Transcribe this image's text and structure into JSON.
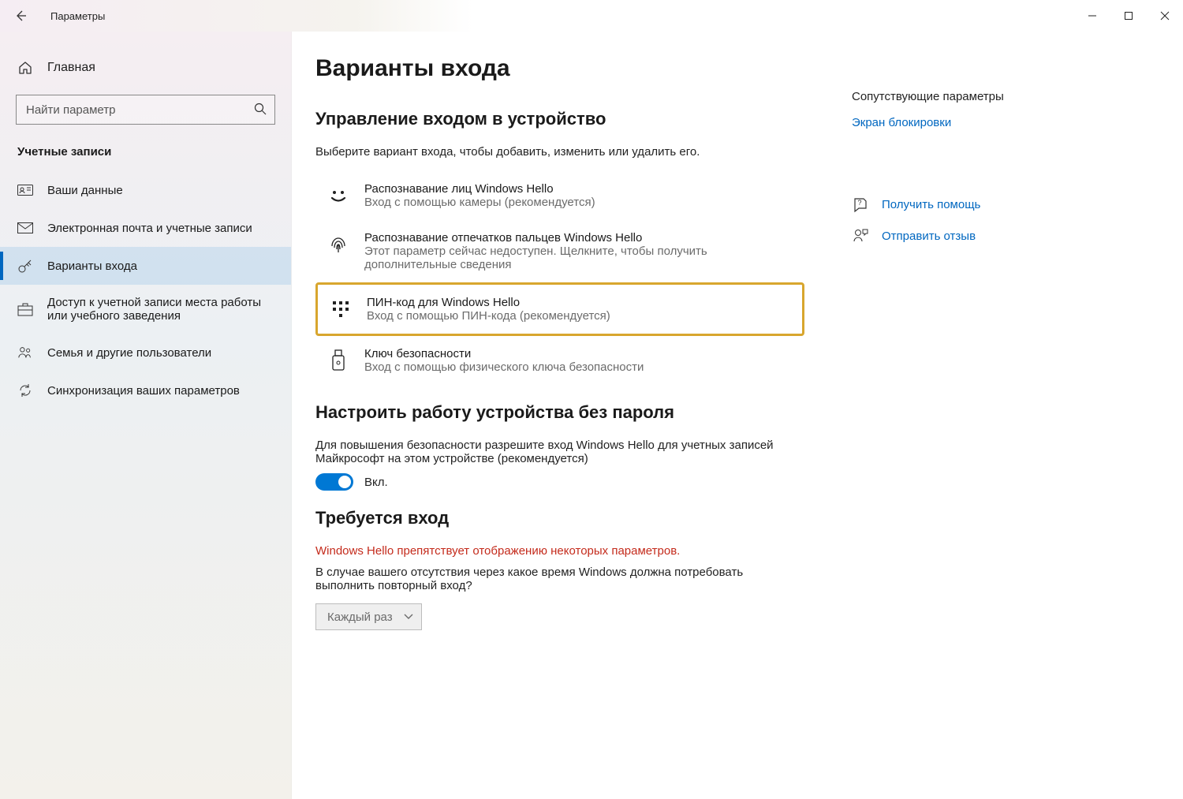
{
  "window": {
    "title": "Параметры"
  },
  "sidebar": {
    "home": "Главная",
    "search_placeholder": "Найти параметр",
    "category": "Учетные записи",
    "items": [
      {
        "label": "Ваши данные"
      },
      {
        "label": "Электронная почта и учетные записи"
      },
      {
        "label": "Варианты входа"
      },
      {
        "label": "Доступ к учетной записи места работы или учебного заведения"
      },
      {
        "label": "Семья и другие пользователи"
      },
      {
        "label": "Синхронизация ваших параметров"
      }
    ]
  },
  "main": {
    "title": "Варианты входа",
    "manage_heading": "Управление входом в устройство",
    "manage_lead": "Выберите вариант входа, чтобы добавить, изменить или удалить его.",
    "options": [
      {
        "title": "Распознавание лиц Windows Hello",
        "desc": "Вход с помощью камеры (рекомендуется)"
      },
      {
        "title": "Распознавание отпечатков пальцев Windows Hello",
        "desc": "Этот параметр сейчас недоступен. Щелкните, чтобы получить дополнительные сведения"
      },
      {
        "title": "ПИН-код для Windows Hello",
        "desc": "Вход с помощью ПИН-кода (рекомендуется)"
      },
      {
        "title": "Ключ безопасности",
        "desc": "Вход с помощью физического ключа безопасности"
      }
    ],
    "passwordless_heading": "Настроить работу устройства без пароля",
    "passwordless_lead": "Для повышения безопасности разрешите вход Windows Hello для учетных записей Майкрософт на этом устройстве (рекомендуется)",
    "toggle_label": "Вкл.",
    "require_heading": "Требуется вход",
    "require_warning": "Windows Hello препятствует отображению некоторых параметров.",
    "require_text": "В случае вашего отсутствия через какое время Windows должна потребовать выполнить повторный вход?",
    "require_value": "Каждый раз"
  },
  "aside": {
    "related_heading": "Сопутствующие параметры",
    "lockscreen": "Экран блокировки",
    "help": "Получить помощь",
    "feedback": "Отправить отзыв"
  }
}
